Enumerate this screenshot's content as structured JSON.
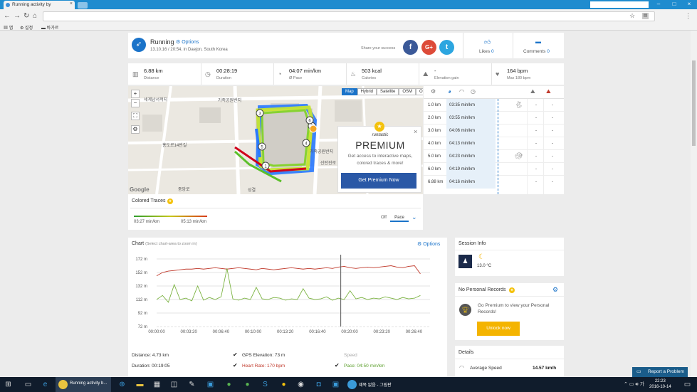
{
  "browser": {
    "tab_title": "Running activity by",
    "bookmarks": [
      "앱",
      "설정",
      "바가르"
    ]
  },
  "header": {
    "activity": "Running",
    "options": "Options",
    "meta": "13.10.16 / 20:54, in Daejon, South Korea",
    "share_label": "Share your success",
    "social": [
      {
        "name": "facebook",
        "glyph": "f",
        "color": "#3b5998"
      },
      {
        "name": "google-plus",
        "glyph": "G+",
        "color": "#dd4b39"
      },
      {
        "name": "twitter",
        "glyph": "t",
        "color": "#2ca6e0"
      }
    ],
    "likes_label": "Likes",
    "likes_count": "0",
    "comments_label": "Comments",
    "comments_count": "0"
  },
  "stats": [
    {
      "icon": "distance-icon",
      "glyph": "▥",
      "value": "6.88 km",
      "label": "Distance"
    },
    {
      "icon": "clock-icon",
      "glyph": "◷",
      "value": "00:28:19",
      "label": "Duration"
    },
    {
      "icon": "pace-icon",
      "glyph": "◔",
      "value": "04:07 min/km",
      "label": "Ø Pace"
    },
    {
      "icon": "flame-icon",
      "glyph": "♨",
      "value": "503 kcal",
      "label": "Calories"
    },
    {
      "icon": "elevation-icon",
      "glyph": "⛰",
      "value": "-",
      "label": "Elevation gain"
    },
    {
      "icon": "heart-icon",
      "glyph": "♥",
      "value": "164 bpm",
      "label": "Max 180 bpm"
    }
  ],
  "map": {
    "types": [
      "Map",
      "Hybrid",
      "Satellite",
      "OSM",
      "OCM"
    ],
    "active_type": "Map",
    "provider": "Google",
    "street_labels": [
      "가족공원반지",
      "세계남서적지",
      "홍도로14번길",
      "가족공원반지",
      "중앙로",
      "성결",
      "신탄진로"
    ],
    "km_markers": [
      "1",
      "2",
      "3",
      "4",
      "5",
      "6"
    ]
  },
  "premium": {
    "logo": "runtastic",
    "title": "PREMIUM",
    "text": "Get access to interactive maps, colored traces & more!",
    "button": "Get Premium Now"
  },
  "splits": {
    "rows": [
      {
        "km": "1.0 km",
        "pace": "03:35 min/km",
        "d1": "-",
        "d2": "-",
        "icon": "rabbit"
      },
      {
        "km": "2.0 km",
        "pace": "03:55 min/km",
        "d1": "-",
        "d2": "-",
        "icon": ""
      },
      {
        "km": "3.0 km",
        "pace": "04:06 min/km",
        "d1": "-",
        "d2": "-",
        "icon": ""
      },
      {
        "km": "4.0 km",
        "pace": "04:13 min/km",
        "d1": "-",
        "d2": "-",
        "icon": ""
      },
      {
        "km": "5.0 km",
        "pace": "04:23 min/km",
        "d1": "-",
        "d2": "-",
        "icon": "turtle"
      },
      {
        "km": "6.0 km",
        "pace": "04:19 min/km",
        "d1": "-",
        "d2": "-",
        "icon": ""
      },
      {
        "km": "6.88 km",
        "pace": "04:16 min/km",
        "d1": "-",
        "d2": "-",
        "icon": ""
      }
    ]
  },
  "traces": {
    "title": "Colored Traces",
    "min": "03:27 min/km",
    "max": "05:13 min/km",
    "off": "Off",
    "pace": "Pace"
  },
  "chart": {
    "title": "Chart",
    "subtitle": "(Select chart-area to zoom in)",
    "options": "Options",
    "legend": {
      "distance": "Distance: 4.73 km",
      "duration": "Duration: 00:19:05",
      "gps": "GPS Elevation: 73 m",
      "heart": "Heart Rate: 170 bpm",
      "speed": "Speed",
      "pace": "Pace: 04:50 min/km"
    }
  },
  "chart_data": {
    "type": "line",
    "ylabel": "",
    "yticks": [
      "172 m",
      "152 m",
      "132 m",
      "112 m",
      "92 m",
      "72 m"
    ],
    "ylim": [
      72,
      172
    ],
    "xticks": [
      "00:00:00",
      "00:03:20",
      "00:06:40",
      "00:10:00",
      "00:13:20",
      "00:16:40",
      "00:20:00",
      "00:23:20",
      "00:26:40"
    ],
    "x_seconds": [
      0,
      200,
      400,
      600,
      800,
      1000,
      1200,
      1400,
      1600
    ],
    "cursor_seconds": 1145,
    "series": [
      {
        "color": "#c0392b",
        "values": [
          147,
          152,
          154,
          155,
          156,
          157,
          157,
          158,
          157,
          158,
          159,
          158,
          157,
          158,
          159,
          158,
          157,
          156,
          158,
          157,
          156,
          157,
          158,
          159,
          158,
          157,
          158,
          157,
          158,
          159,
          158,
          160,
          161,
          159,
          158,
          159,
          160,
          159,
          160,
          161,
          162,
          160,
          159,
          161,
          162,
          150
        ]
      },
      {
        "color": "#7cb342",
        "values": [
          112,
          118,
          108,
          134,
          112,
          114,
          110,
          132,
          111,
          115,
          112,
          116,
          158,
          113,
          111,
          114,
          112,
          130,
          113,
          112,
          115,
          114,
          111,
          113,
          112,
          128,
          114,
          112,
          113,
          116,
          111,
          114,
          112,
          125,
          113,
          115,
          112,
          114,
          113,
          116,
          114,
          112,
          115,
          113,
          114,
          118
        ]
      }
    ]
  },
  "session": {
    "title": "Session Info",
    "temp": "13.0 °C"
  },
  "records": {
    "title": "No Personal Records",
    "text": "Go Premium to view your Personal Records!",
    "button": "Unlock now"
  },
  "details": {
    "title": "Details",
    "label": "Average Speed",
    "value": "14.57 km/h"
  },
  "report_button": "Report a Problem",
  "taskbar": {
    "chrome_app": "Running activity b...",
    "paint_app": "제목 없음 - 그림판",
    "time": "22:23",
    "date": "2016-10-14",
    "lang": "가"
  }
}
